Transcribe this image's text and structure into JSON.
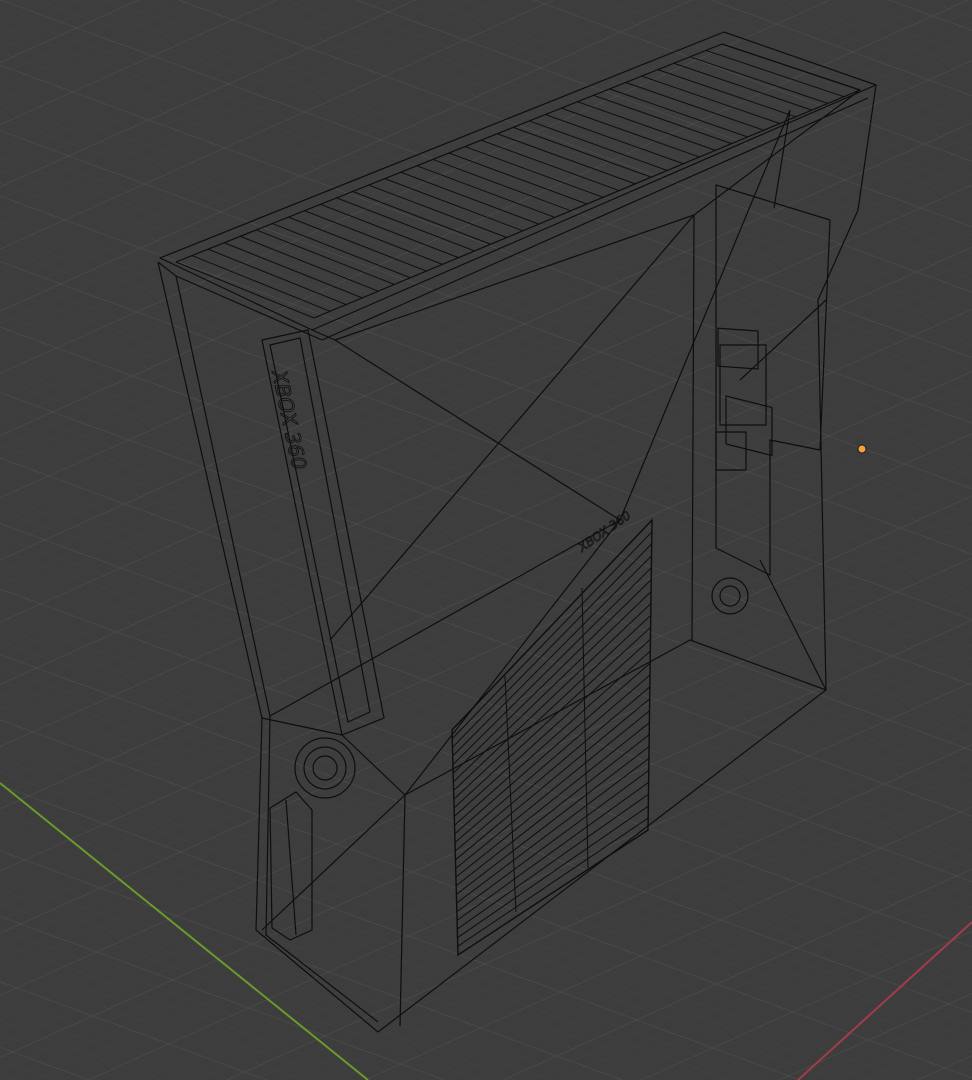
{
  "viewport": {
    "mode": "wireframe",
    "object": "xbox-360-slim-console-model",
    "colors": {
      "background": "#3d3d3d",
      "grid_minor": "#474747",
      "grid_major": "#555555",
      "wire": "#0e0e0e",
      "x_axis": "#a33b4b",
      "y_axis": "#6a9a2a",
      "light": "#f2a33a"
    }
  },
  "labels": {
    "front_logo": "XBOX 360",
    "side_logo": "XBOX 360"
  }
}
